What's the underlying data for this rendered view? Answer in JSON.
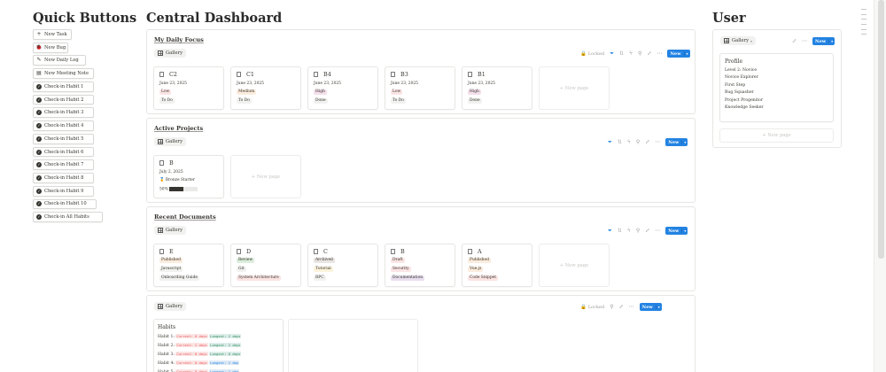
{
  "headings": {
    "quick": "Quick Buttons",
    "central": "Central Dashboard",
    "user": "User"
  },
  "quick_buttons": [
    {
      "label": "New Task",
      "icon": "plus-icon"
    },
    {
      "label": "New Bug",
      "icon": "bug-icon"
    },
    {
      "label": "New Daily Log",
      "icon": "edit-icon"
    },
    {
      "label": "New Meeting Note",
      "icon": "document-icon"
    },
    {
      "label": "Check-in Habit 1",
      "icon": "check-circle-icon"
    },
    {
      "label": "Check-in Habit 2",
      "icon": "check-circle-icon"
    },
    {
      "label": "Check-in Habit 3",
      "icon": "check-circle-icon"
    },
    {
      "label": "Check-in Habit 4",
      "icon": "check-circle-icon"
    },
    {
      "label": "Check-in Habit 5",
      "icon": "check-circle-icon"
    },
    {
      "label": "Check-in Habit 6",
      "icon": "check-circle-icon"
    },
    {
      "label": "Check-in Habit 7",
      "icon": "check-circle-icon"
    },
    {
      "label": "Check-in Habit 8",
      "icon": "check-circle-icon"
    },
    {
      "label": "Check-in Habit 9",
      "icon": "check-circle-icon"
    },
    {
      "label": "Check-in Habit 10",
      "icon": "check-circle-icon"
    },
    {
      "label": "Check-in All Habits",
      "icon": "check-circle-icon"
    }
  ],
  "view_label": "Gallery",
  "new_label": "New",
  "locked_label": "Locked",
  "new_page_label": "+ New page",
  "focus": {
    "title": "My Daily Focus",
    "cards": [
      {
        "title": "C2",
        "date": "June 23, 2025",
        "priority": "Low",
        "status": "To Do"
      },
      {
        "title": "C1",
        "date": "June 23, 2025",
        "priority": "Medium",
        "status": "To Do"
      },
      {
        "title": "B4",
        "date": "June 23, 2025",
        "priority": "High",
        "status": "Done"
      },
      {
        "title": "B3",
        "date": "June 23, 2025",
        "priority": "Low",
        "status": "To Do"
      },
      {
        "title": "B1",
        "date": "June 23, 2025",
        "priority": "High",
        "status": "Done"
      }
    ]
  },
  "projects": {
    "title": "Active Projects",
    "cards": [
      {
        "title": "B",
        "date": "July 2, 2025",
        "badge": "🏅 Bronze Starter",
        "progress_label": "50%",
        "progress": 0.5
      }
    ]
  },
  "documents": {
    "title": "Recent Documents",
    "cards": [
      {
        "title": "E",
        "status": "Published",
        "tech": "Javascript",
        "type": "Onboarding Guide"
      },
      {
        "title": "D",
        "status": "Review",
        "tech": "Git",
        "type": "System Architecture"
      },
      {
        "title": "C",
        "status": "Archived",
        "tech": "Tutorial",
        "type": "RPC"
      },
      {
        "title": "B",
        "status": "Draft",
        "tech": "Security",
        "type": "Documentation"
      },
      {
        "title": "A",
        "status": "Published",
        "tech": "Vue.js",
        "type": "Code Snippet"
      }
    ]
  },
  "habits": {
    "title": "Habits",
    "rows": [
      {
        "label": "Habit 1:",
        "current": "Current: 0 days",
        "longest": "Longest: 2 days"
      },
      {
        "label": "Habit 2:",
        "current": "Current: 2 days",
        "longest": "Longest: 2 days"
      },
      {
        "label": "Habit 3:",
        "current": "Current: 0 days",
        "longest": "Longest: 0 days"
      },
      {
        "label": "Habit 4:",
        "current": "Current: 0 days",
        "longest": "Longest: 1 day"
      },
      {
        "label": "Habit 5:",
        "current": "Current: 0 days",
        "longest": "Longest: 1 day"
      }
    ]
  },
  "user": {
    "profile_title": "Profile",
    "items": [
      "Level 2: Novice",
      "Novice Explorer",
      "First Step",
      "Bug Squasher",
      "Project Progenitor",
      "Knowledge Seeker"
    ]
  },
  "colors": {
    "accent": "#2383e2",
    "low_bg": "#fbe4e4",
    "medium_bg": "#fbecdd",
    "high_bg": "#f4dfeb",
    "published_bg": "#fbecdd",
    "review_bg": "#dbeddb",
    "archived_bg": "#e9e5e3",
    "draft_bg": "#fbe4e4",
    "tutorial_bg": "#fbf3db",
    "security_bg": "#fbe4e4",
    "documentation_bg": "#e8deee",
    "javascript_bg": "#f1f1ef",
    "type_bg": "#fbe4e4"
  }
}
